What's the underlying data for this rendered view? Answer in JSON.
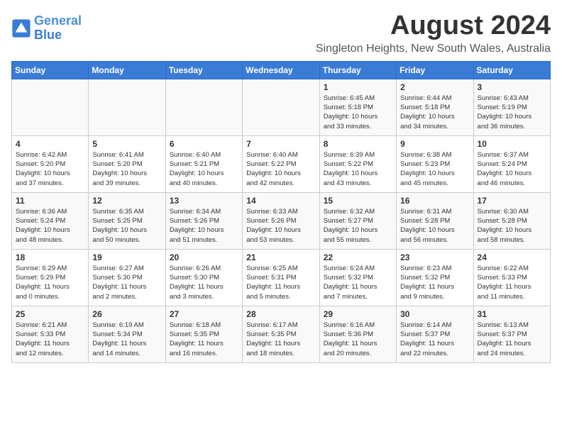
{
  "logo": {
    "line1": "General",
    "line2": "Blue"
  },
  "title": "August 2024",
  "subtitle": "Singleton Heights, New South Wales, Australia",
  "days_of_week": [
    "Sunday",
    "Monday",
    "Tuesday",
    "Wednesday",
    "Thursday",
    "Friday",
    "Saturday"
  ],
  "weeks": [
    [
      {
        "day": "",
        "info": ""
      },
      {
        "day": "",
        "info": ""
      },
      {
        "day": "",
        "info": ""
      },
      {
        "day": "",
        "info": ""
      },
      {
        "day": "1",
        "info": "Sunrise: 6:45 AM\nSunset: 5:18 PM\nDaylight: 10 hours\nand 33 minutes."
      },
      {
        "day": "2",
        "info": "Sunrise: 6:44 AM\nSunset: 5:18 PM\nDaylight: 10 hours\nand 34 minutes."
      },
      {
        "day": "3",
        "info": "Sunrise: 6:43 AM\nSunset: 5:19 PM\nDaylight: 10 hours\nand 36 minutes."
      }
    ],
    [
      {
        "day": "4",
        "info": "Sunrise: 6:42 AM\nSunset: 5:20 PM\nDaylight: 10 hours\nand 37 minutes."
      },
      {
        "day": "5",
        "info": "Sunrise: 6:41 AM\nSunset: 5:20 PM\nDaylight: 10 hours\nand 39 minutes."
      },
      {
        "day": "6",
        "info": "Sunrise: 6:40 AM\nSunset: 5:21 PM\nDaylight: 10 hours\nand 40 minutes."
      },
      {
        "day": "7",
        "info": "Sunrise: 6:40 AM\nSunset: 5:22 PM\nDaylight: 10 hours\nand 42 minutes."
      },
      {
        "day": "8",
        "info": "Sunrise: 6:39 AM\nSunset: 5:22 PM\nDaylight: 10 hours\nand 43 minutes."
      },
      {
        "day": "9",
        "info": "Sunrise: 6:38 AM\nSunset: 5:23 PM\nDaylight: 10 hours\nand 45 minutes."
      },
      {
        "day": "10",
        "info": "Sunrise: 6:37 AM\nSunset: 5:24 PM\nDaylight: 10 hours\nand 46 minutes."
      }
    ],
    [
      {
        "day": "11",
        "info": "Sunrise: 6:36 AM\nSunset: 5:24 PM\nDaylight: 10 hours\nand 48 minutes."
      },
      {
        "day": "12",
        "info": "Sunrise: 6:35 AM\nSunset: 5:25 PM\nDaylight: 10 hours\nand 50 minutes."
      },
      {
        "day": "13",
        "info": "Sunrise: 6:34 AM\nSunset: 5:26 PM\nDaylight: 10 hours\nand 51 minutes."
      },
      {
        "day": "14",
        "info": "Sunrise: 6:33 AM\nSunset: 5:26 PM\nDaylight: 10 hours\nand 53 minutes."
      },
      {
        "day": "15",
        "info": "Sunrise: 6:32 AM\nSunset: 5:27 PM\nDaylight: 10 hours\nand 55 minutes."
      },
      {
        "day": "16",
        "info": "Sunrise: 6:31 AM\nSunset: 5:28 PM\nDaylight: 10 hours\nand 56 minutes."
      },
      {
        "day": "17",
        "info": "Sunrise: 6:30 AM\nSunset: 5:28 PM\nDaylight: 10 hours\nand 58 minutes."
      }
    ],
    [
      {
        "day": "18",
        "info": "Sunrise: 6:29 AM\nSunset: 5:29 PM\nDaylight: 11 hours\nand 0 minutes."
      },
      {
        "day": "19",
        "info": "Sunrise: 6:27 AM\nSunset: 5:30 PM\nDaylight: 11 hours\nand 2 minutes."
      },
      {
        "day": "20",
        "info": "Sunrise: 6:26 AM\nSunset: 5:30 PM\nDaylight: 11 hours\nand 3 minutes."
      },
      {
        "day": "21",
        "info": "Sunrise: 6:25 AM\nSunset: 5:31 PM\nDaylight: 11 hours\nand 5 minutes."
      },
      {
        "day": "22",
        "info": "Sunrise: 6:24 AM\nSunset: 5:32 PM\nDaylight: 11 hours\nand 7 minutes."
      },
      {
        "day": "23",
        "info": "Sunrise: 6:23 AM\nSunset: 5:32 PM\nDaylight: 11 hours\nand 9 minutes."
      },
      {
        "day": "24",
        "info": "Sunrise: 6:22 AM\nSunset: 5:33 PM\nDaylight: 11 hours\nand 11 minutes."
      }
    ],
    [
      {
        "day": "25",
        "info": "Sunrise: 6:21 AM\nSunset: 5:33 PM\nDaylight: 11 hours\nand 12 minutes."
      },
      {
        "day": "26",
        "info": "Sunrise: 6:19 AM\nSunset: 5:34 PM\nDaylight: 11 hours\nand 14 minutes."
      },
      {
        "day": "27",
        "info": "Sunrise: 6:18 AM\nSunset: 5:35 PM\nDaylight: 11 hours\nand 16 minutes."
      },
      {
        "day": "28",
        "info": "Sunrise: 6:17 AM\nSunset: 5:35 PM\nDaylight: 11 hours\nand 18 minutes."
      },
      {
        "day": "29",
        "info": "Sunrise: 6:16 AM\nSunset: 5:36 PM\nDaylight: 11 hours\nand 20 minutes."
      },
      {
        "day": "30",
        "info": "Sunrise: 6:14 AM\nSunset: 5:37 PM\nDaylight: 11 hours\nand 22 minutes."
      },
      {
        "day": "31",
        "info": "Sunrise: 6:13 AM\nSunset: 5:37 PM\nDaylight: 11 hours\nand 24 minutes."
      }
    ]
  ]
}
